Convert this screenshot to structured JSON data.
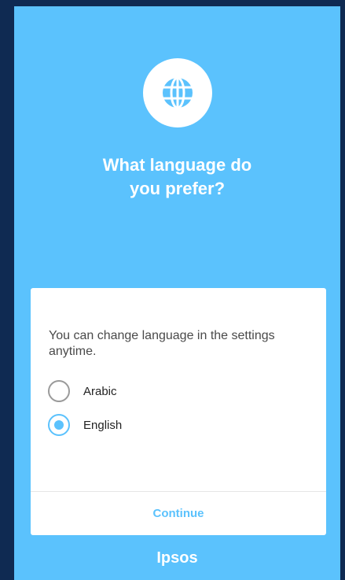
{
  "header": {
    "icon": "globe-icon",
    "title_line1": "What language do",
    "title_line2": "you prefer?"
  },
  "card": {
    "info_text": "You can change language in the settings anytime.",
    "options": [
      {
        "label": "Arabic",
        "selected": false
      },
      {
        "label": "English",
        "selected": true
      }
    ],
    "continue_label": "Continue"
  },
  "footer": {
    "brand": "Ipsos"
  },
  "colors": {
    "accent": "#5bc2fd",
    "background": "#0f2a52",
    "card": "#ffffff"
  }
}
